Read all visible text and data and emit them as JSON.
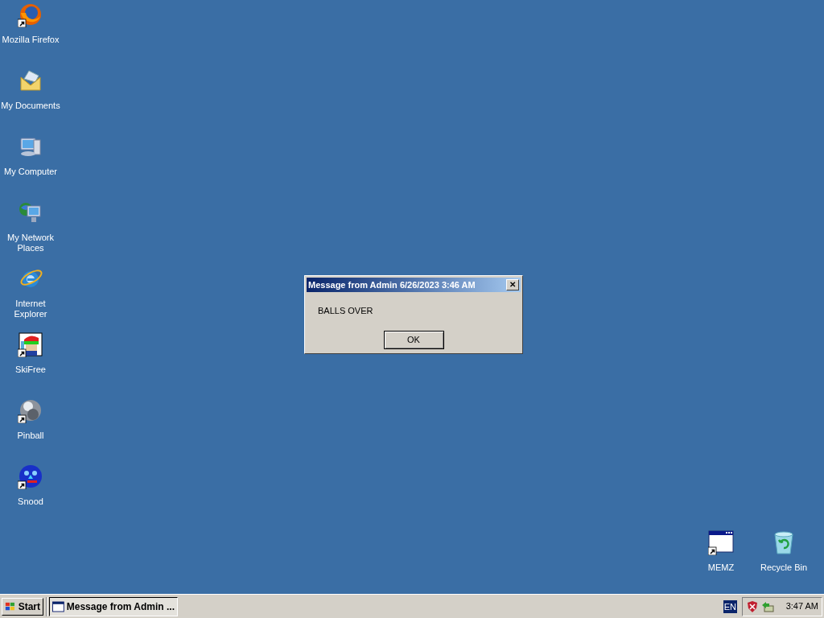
{
  "desktop_icons": [
    {
      "label": "Mozilla Firefox",
      "kind": "firefox",
      "shortcut": true
    },
    {
      "label": "My Documents",
      "kind": "documents",
      "shortcut": false
    },
    {
      "label": "My Computer",
      "kind": "computer",
      "shortcut": false
    },
    {
      "label": "My Network Places",
      "kind": "network",
      "shortcut": false
    },
    {
      "label": "Internet Explorer",
      "kind": "ie",
      "shortcut": false
    },
    {
      "label": "SkiFree",
      "kind": "skifree",
      "shortcut": true
    },
    {
      "label": "Pinball",
      "kind": "pinball",
      "shortcut": true
    },
    {
      "label": "Snood",
      "kind": "snood",
      "shortcut": true
    }
  ],
  "corner_icons": [
    {
      "label": "MEMZ",
      "kind": "window",
      "shortcut": true
    },
    {
      "label": "Recycle Bin",
      "kind": "recycle",
      "shortcut": false
    }
  ],
  "dialog": {
    "title": "Message from Admin 6/26/2023 3:46 AM",
    "close": "✕",
    "message": "BALLS OVER",
    "button": "OK"
  },
  "taskbar": {
    "start": "Start",
    "tasks": [
      {
        "label": "Message from Admin ...",
        "selected": true
      }
    ],
    "language": "EN",
    "clock": "3:47 AM"
  }
}
